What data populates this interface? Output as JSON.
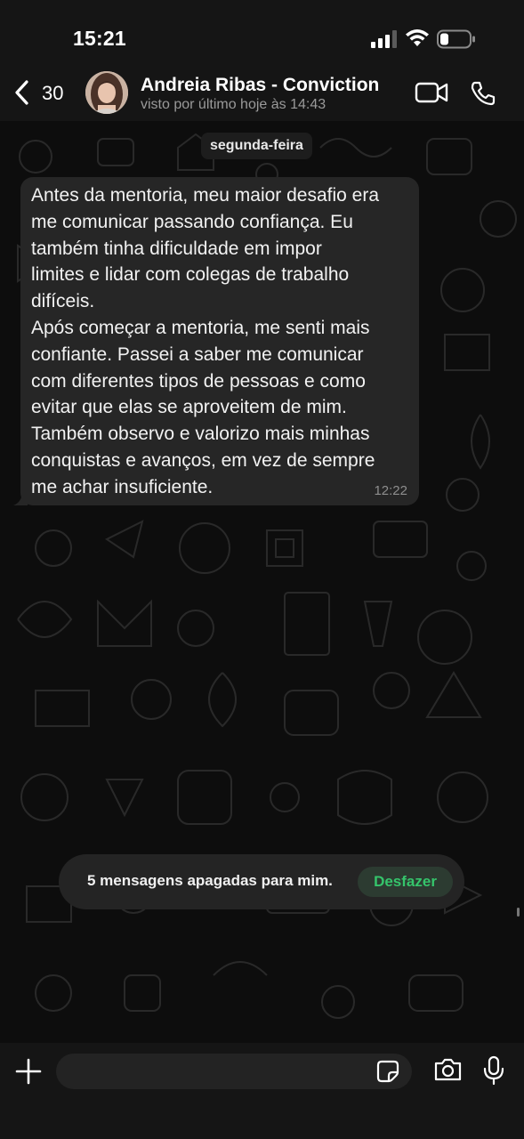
{
  "status": {
    "time": "15:21"
  },
  "header": {
    "unread_count": "30",
    "contact_name": "Andreia Ribas - Conviction",
    "last_seen": "visto por último hoje às 14:43",
    "icons": [
      "back-chevron-icon",
      "video-call-icon",
      "voice-call-icon"
    ]
  },
  "chat": {
    "date_label": "segunda-feira",
    "messages": [
      {
        "text": "Antes da mentoria, meu maior desafio era\nme comunicar passando confiança. Eu\ntambém tinha dificuldade em impor\nlimites e lidar com colegas de trabalho\ndifíceis.\nApós começar a mentoria, me senti mais\nconfiante. Passei a saber me comunicar\ncom diferentes tipos de pessoas e como\nevitar que elas se aproveitem de mim.\nTambém observo e valorizo mais minhas\nconquistas e avanços, em vez de sempre\nme achar insuficiente.",
        "time": "12:22"
      }
    ]
  },
  "toast": {
    "text": "5 mensagens apagadas para mim.",
    "action_label": "Desfazer"
  },
  "composer": {
    "input_value": "",
    "icons": [
      "plus-icon",
      "sticker-icon",
      "camera-icon",
      "microphone-icon"
    ]
  },
  "colors": {
    "background": "#0b0b0b",
    "bar": "#151515",
    "bubble": "#262626",
    "accent_green": "#35c46b"
  }
}
